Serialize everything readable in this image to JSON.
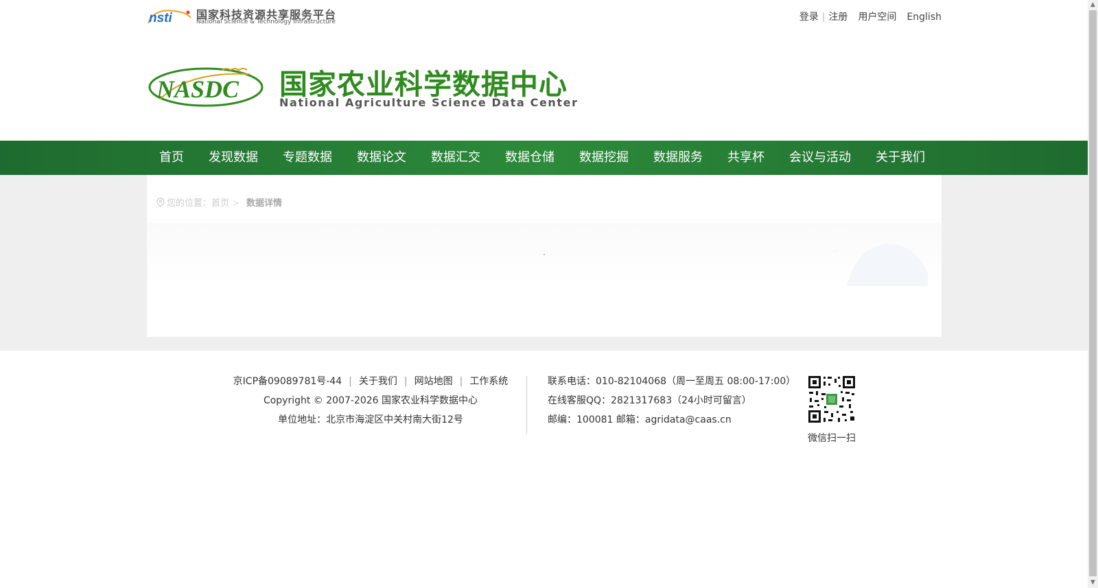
{
  "topbar": {
    "platform_title": "国家科技资源共享服务平台",
    "platform_subtitle": "National Science & Technology Infrastructure",
    "platform_mark": "nsti",
    "login": "登录",
    "register": "注册",
    "user_space": "用户空间",
    "english": "English"
  },
  "header": {
    "title": "国家农业科学数据中心",
    "subtitle": "National Agriculture Science Data Center",
    "logo_text": "NASDC"
  },
  "nav": {
    "items": [
      "首页",
      "发现数据",
      "专题数据",
      "数据论文",
      "数据汇交",
      "数据仓储",
      "数据挖掘",
      "数据服务",
      "共享杯",
      "会议与活动",
      "关于我们"
    ]
  },
  "breadcrumb": {
    "prefix": "您的位置：",
    "home": "首页",
    "separator": ">",
    "current": "数据详情"
  },
  "footer": {
    "icp": "京ICP备09089781号-44",
    "about": "关于我们",
    "sitemap": "网站地图",
    "work_system": "工作系统",
    "separator": "|",
    "copyright": "Copyright © 2007-2026 国家农业科学数据中心",
    "address": "单位地址：北京市海淀区中关村南大街12号",
    "phone": "联系电话：010-82104068（周一至周五 08:00-17:00）",
    "qq": "在线客服QQ：2821317683（24小时可留言）",
    "postal": "邮编：100081 邮箱：agridata@caas.cn",
    "qr_caption": "微信扫一扫"
  },
  "colors": {
    "nav_green": "#2c8a3a",
    "brand_green": "#2e8b1e",
    "page_gray": "#efefef"
  }
}
